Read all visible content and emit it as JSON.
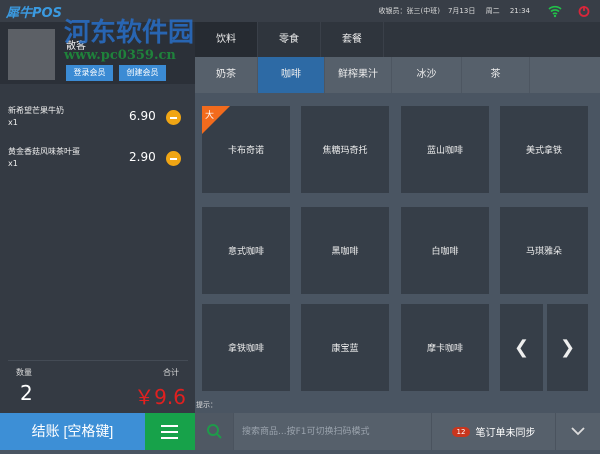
{
  "app": {
    "name": "犀牛POS",
    "watermark": "河东软件园",
    "watermark_url": "www.pc0359.cn"
  },
  "status": {
    "cashier": "收银员：张三(中班)",
    "date": "7月13日",
    "weekday": "周二",
    "time": "21:34"
  },
  "customer": {
    "name": "散客",
    "login_label": "登录会员",
    "create_label": "创建会员"
  },
  "order": [
    {
      "name": "新希望芒果牛奶",
      "qty": "x1",
      "price": "6.90"
    },
    {
      "name": "黄金香菇风味茶叶蛋",
      "qty": "x1",
      "price": "2.90"
    }
  ],
  "totals": {
    "qty_label": "数量",
    "sum_label": "合计",
    "qty": "2",
    "sum": "￥9.6"
  },
  "checkout_label": "结账 [空格键]",
  "categories": [
    "饮料",
    "零食",
    "套餐"
  ],
  "subcategories": [
    "奶茶",
    "咖啡",
    "鲜榨果汁",
    "冰沙",
    "茶"
  ],
  "products": [
    "卡布奇诺",
    "焦糖玛奇托",
    "蓝山咖啡",
    "美式拿铁",
    "意式咖啡",
    "黑咖啡",
    "白咖啡",
    "马琪雅朵",
    "拿铁咖啡",
    "康宝蓝",
    "摩卡咖啡"
  ],
  "product_badge": "大",
  "tip_label": "提示：",
  "search": {
    "placeholder": "搜索商品...按F1可切换扫码模式"
  },
  "sync": {
    "count": "12",
    "label": "笔订单未同步"
  },
  "colors": {
    "accent": "#3d8fd6",
    "green": "#17a24a",
    "badge": "#f26b1d",
    "total": "#e02020"
  }
}
